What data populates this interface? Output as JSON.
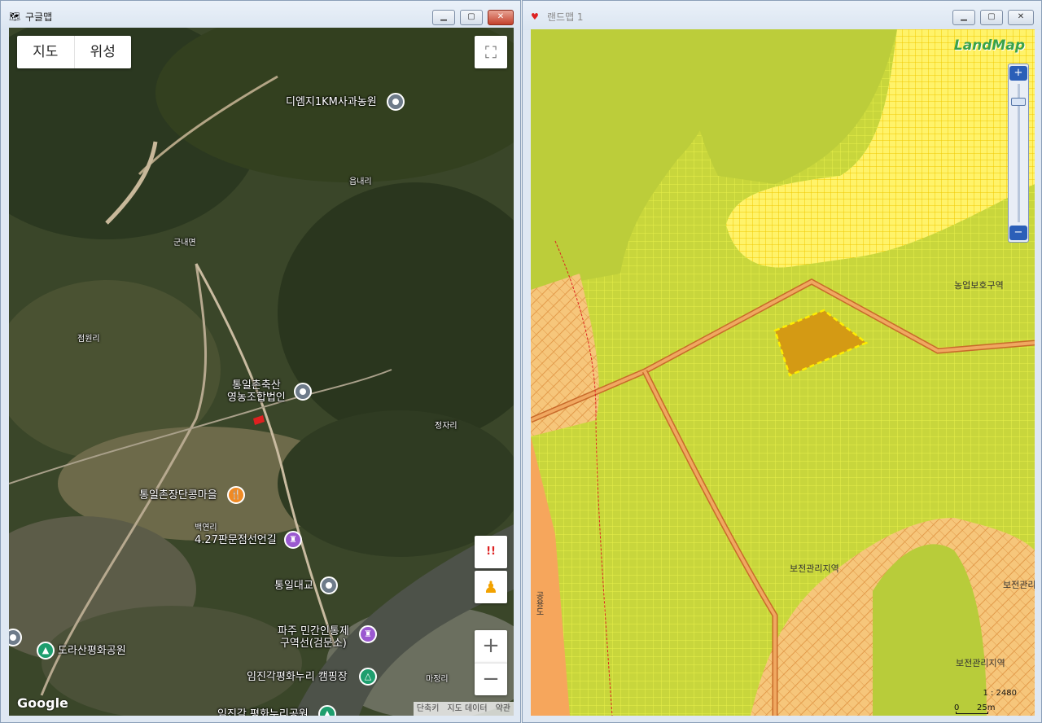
{
  "google_window": {
    "title": "구글맵",
    "toggle": {
      "map": "지도",
      "satellite": "위성"
    },
    "pins": [
      {
        "label": "디엠지1KM사과농원"
      },
      {
        "label": "통일촌축산\n영농조합법인"
      },
      {
        "label": "통일촌장단콩마을"
      },
      {
        "label": "4.27판문점선언길"
      },
      {
        "label": "통일대교"
      },
      {
        "label": "파주 민간인통제\n구역선(검문소)"
      },
      {
        "label": "도라산평화공원"
      },
      {
        "label": "임진각평화누리 캠핑장"
      },
      {
        "label": "임진각 평화누리공원"
      }
    ],
    "areas": [
      "읍내리",
      "군내면",
      "점원리",
      "정자리",
      "백연리",
      "마정리"
    ],
    "logo": "Google",
    "attribution": [
      "단축키",
      "지도 데이터",
      "약관"
    ],
    "alert_glyph": "!!"
  },
  "land_window": {
    "title": "랜드맵 1",
    "logo": "LandMap",
    "zones": [
      "농업보호구역",
      "보전관리지역",
      "보전관리",
      "보전관리지역"
    ],
    "road_label": "공용도",
    "scale_ratio": "1 : 2480",
    "scale_bar": {
      "start": "0",
      "end": "25m"
    }
  },
  "colors": {
    "agri": "#c8d63c",
    "preserve": "#f6c67b",
    "upland": "#fff36a",
    "parcel": "#d49a14",
    "road": "#f0a860"
  }
}
